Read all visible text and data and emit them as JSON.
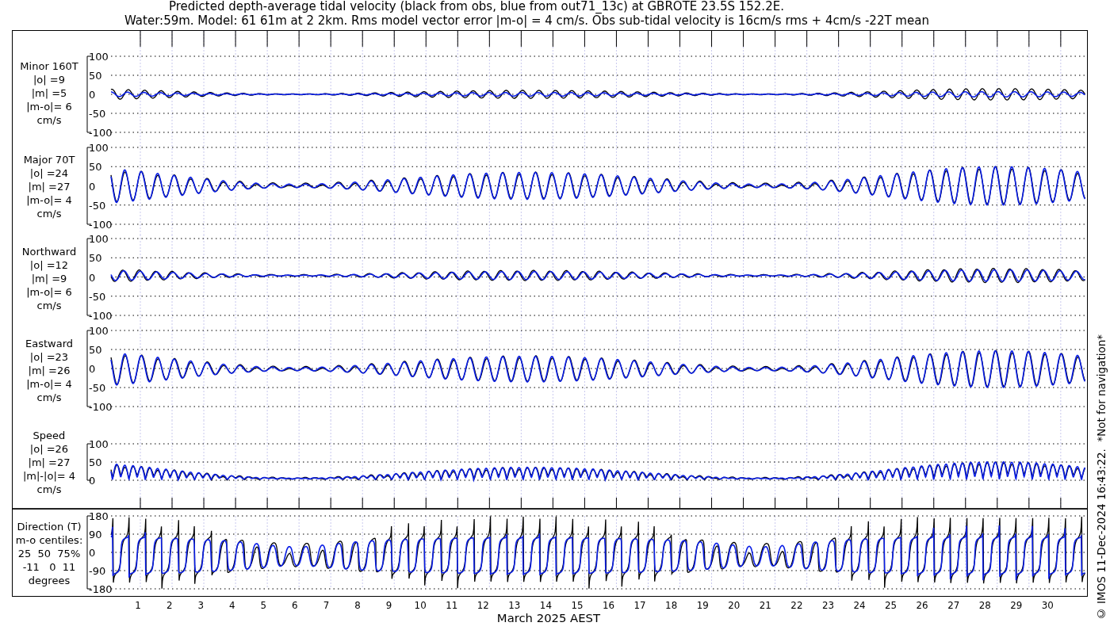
{
  "title_lines": [
    "Predicted depth-average tidal velocity (black from obs, blue from out71_13c) at GBROTE 23.5S 152.2E.",
    "Water:59m. Model: 61 61m at 2 2km. Rms model vector error |m-o| = 4 cm/s. Obs sub-tidal velocity is 16cm/s rms + 4cm/s -22T mean"
  ],
  "panels": [
    {
      "kind": "minor",
      "label_lines": [
        "Minor 160T",
        "|o| =9",
        "|m| =5",
        "|m-o|= 6",
        "cm/s"
      ],
      "yticks": [
        "100",
        "50",
        "0",
        "-50",
        "-100"
      ]
    },
    {
      "kind": "major",
      "label_lines": [
        "Major 70T",
        "|o| =24",
        "|m| =27",
        "|m-o|= 4",
        "cm/s"
      ],
      "yticks": [
        "100",
        "50",
        "0",
        "-50",
        "-100"
      ]
    },
    {
      "kind": "northward",
      "label_lines": [
        "Northward",
        "|o| =12",
        "|m| =9",
        "|m-o|= 6",
        "cm/s"
      ],
      "yticks": [
        "100",
        "50",
        "0",
        "-50",
        "-100"
      ]
    },
    {
      "kind": "eastward",
      "label_lines": [
        "Eastward",
        "|o| =23",
        "|m| =26",
        "|m-o|= 4",
        "cm/s"
      ],
      "yticks": [
        "100",
        "50",
        "0",
        "-50",
        "-100"
      ]
    },
    {
      "kind": "speed",
      "label_lines": [
        "Speed",
        "|o| =26",
        "|m| =27",
        "|m|-|o|= 4",
        "cm/s"
      ],
      "yticks": [
        "100",
        "50",
        "0"
      ]
    },
    {
      "kind": "direction",
      "label_lines": [
        "Direction (T)",
        "m-o centiles:",
        "25  50  75%",
        "-11   0  11",
        "degrees"
      ],
      "yticks": [
        "180",
        "90",
        "0",
        "-90",
        "-180"
      ]
    }
  ],
  "x_labels": [
    "1",
    "2",
    "3",
    "4",
    "5",
    "6",
    "7",
    "8",
    "9",
    "10",
    "11",
    "12",
    "13",
    "14",
    "15",
    "16",
    "17",
    "18",
    "19",
    "20",
    "21",
    "22",
    "23",
    "24",
    "25",
    "26",
    "27",
    "28",
    "29",
    "30"
  ],
  "xlabel": "March 2025 AEST",
  "side_note": "© IMOS 11-Dec-2024 16:43:22.  *Not for navigation*"
}
